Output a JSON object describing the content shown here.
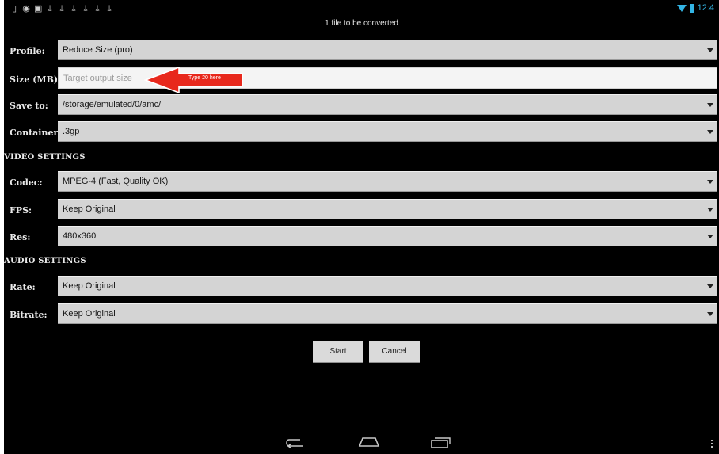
{
  "header": {
    "subtitle": "1  file to be converted",
    "clock": "12:4"
  },
  "form": {
    "profile": {
      "label": "Profile:",
      "value": "Reduce Size (pro)"
    },
    "size": {
      "label": "Size (MB):",
      "placeholder": "Target output size"
    },
    "save_to": {
      "label": "Save to:",
      "value": "/storage/emulated/0/amc/"
    },
    "container": {
      "label": "Container:",
      "value": ".3gp"
    }
  },
  "video_settings": {
    "title": "VIDEO SETTINGS",
    "codec": {
      "label": "Codec:",
      "value": "MPEG-4 (Fast, Quality OK)"
    },
    "fps": {
      "label": "FPS:",
      "value": "Keep Original"
    },
    "res": {
      "label": "Res:",
      "value": "480x360"
    }
  },
  "audio_settings": {
    "title": "AUDIO SETTINGS",
    "rate": {
      "label": "Rate:",
      "value": "Keep Original"
    },
    "bitrate": {
      "label": "Bitrate:",
      "value": "Keep Original"
    }
  },
  "buttons": {
    "start": "Start",
    "cancel": "Cancel"
  },
  "annotation": {
    "text": "Type 20 here"
  },
  "colors": {
    "background": "#000000",
    "field": "#d4d4d4",
    "accent": "#33b5e5",
    "annotation": "#e8281c"
  },
  "icons": {
    "status_left": [
      "phone-icon",
      "camera-icon",
      "image-icon",
      "download-icon",
      "download-icon",
      "download-icon",
      "download-icon",
      "download-icon",
      "download-icon"
    ],
    "status_right": [
      "wifi-icon",
      "battery-icon"
    ],
    "nav": [
      "back-icon",
      "home-icon",
      "recent-apps-icon",
      "overflow-menu-icon"
    ]
  }
}
